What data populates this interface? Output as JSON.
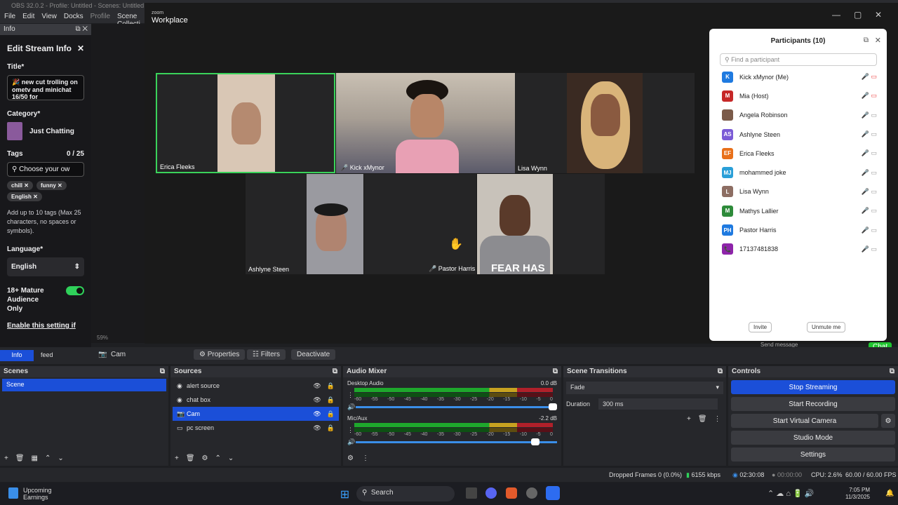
{
  "obs": {
    "title": "OBS 32.0.2 - Profile: Untitled - Scenes: Untitled",
    "menu": [
      "File",
      "Edit",
      "View",
      "Docks",
      "Profile",
      "Scene Collecti"
    ],
    "dock_title": "Info"
  },
  "edit_stream": {
    "heading": "Edit Stream Info",
    "title_label": "Title*",
    "title_value": "🎉 new cut trolling on ometv and minichat 16/50 for",
    "category_label": "Category*",
    "category_value": "Just Chatting",
    "tags_label": "Tags",
    "tags_count": "0 / 25",
    "tags_placeholder": "Choose your ow",
    "tags": [
      "chill",
      "funny",
      "English"
    ],
    "tags_hint": "Add up to 10 tags (Max 25 characters, no spaces or symbols).",
    "language_label": "Language*",
    "language_value": "English",
    "mature_label": "18+ Mature Audience Only",
    "enable_text": "Enable this setting if"
  },
  "zoom": {
    "brand_small": "zoom",
    "brand": "Workplace",
    "tiles": [
      "Erica Fleeks",
      "Kick xMynor",
      "Lisa Wynn",
      "Ashlyne Steen",
      "Pastor Harris"
    ],
    "shirt_text": "FEAR HAS",
    "preview_zoom": "59%"
  },
  "participants": {
    "title": "Participants (10)",
    "search_placeholder": "Find a participant",
    "list": [
      {
        "initials": "K",
        "name": "Kick xMynor (Me)",
        "color": "#1f7ae0"
      },
      {
        "initials": "M",
        "name": "Mia (Host)",
        "color": "#c62828"
      },
      {
        "initials": "",
        "name": "Angela Robinson",
        "color": "#7b5b4a"
      },
      {
        "initials": "AS",
        "name": "Ashlyne Steen",
        "color": "#7b5bd6"
      },
      {
        "initials": "EF",
        "name": "Erica Fleeks",
        "color": "#e8701a"
      },
      {
        "initials": "MJ",
        "name": "mohammed joke",
        "color": "#2a9fd8"
      },
      {
        "initials": "L",
        "name": "Lisa Wynn",
        "color": "#8d6e63"
      },
      {
        "initials": "M",
        "name": "Mathys Lallier",
        "color": "#2e8b3a"
      },
      {
        "initials": "PH",
        "name": "Pastor Harris",
        "color": "#1f7ae0"
      },
      {
        "initials": "📞",
        "name": "17137481838",
        "color": "#8e24aa"
      }
    ],
    "invite": "Invite",
    "unmute": "Unmute me",
    "chat": "Chat",
    "send_message": "Send message"
  },
  "source_toolbar": {
    "tabs": [
      "Info",
      "feed"
    ],
    "source_name": "Cam",
    "properties": "Properties",
    "filters": "Filters",
    "deactivate": "Deactivate"
  },
  "scenes": {
    "title": "Scenes",
    "items": [
      "Scene"
    ]
  },
  "sources": {
    "title": "Sources",
    "items": [
      "alert source",
      "chat box",
      "Cam",
      "pc screen"
    ]
  },
  "mixer": {
    "title": "Audio Mixer",
    "channels": [
      {
        "name": "Desktop Audio",
        "db": "0.0 dB"
      },
      {
        "name": "Mic/Aux",
        "db": "-2.2 dB"
      }
    ],
    "scale": [
      "-60",
      "-55",
      "-50",
      "-45",
      "-40",
      "-35",
      "-30",
      "-25",
      "-20",
      "-15",
      "-10",
      "-5",
      "0"
    ]
  },
  "transitions": {
    "title": "Scene Transitions",
    "type": "Fade",
    "duration_label": "Duration",
    "duration": "300 ms"
  },
  "controls": {
    "title": "Controls",
    "buttons": [
      "Stop Streaming",
      "Start Recording",
      "Start Virtual Camera",
      "Studio Mode",
      "Settings"
    ]
  },
  "status": {
    "dropped": "Dropped Frames 0 (0.0%)",
    "bitrate": "6155 kbps",
    "stream_time": "02:30:08",
    "rec_time": "00:00:00",
    "cpu": "CPU: 2.6%",
    "fps": "60.00 / 60.00 FPS"
  },
  "taskbar": {
    "weather_title": "Upcoming",
    "weather_sub": "Earnings",
    "search": "Search",
    "time": "7:05 PM",
    "date": "11/3/2025"
  }
}
